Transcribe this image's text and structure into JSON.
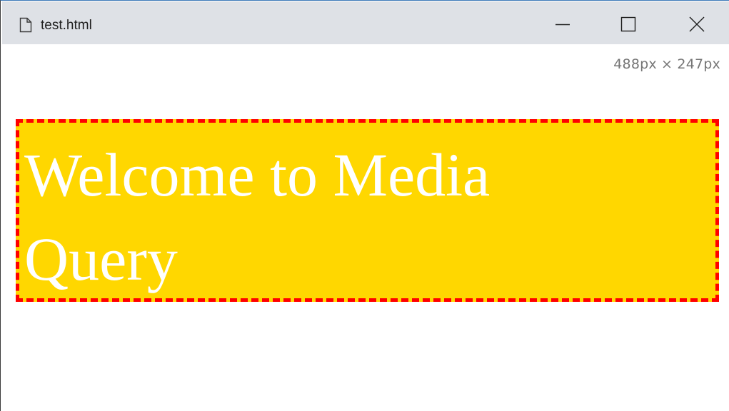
{
  "window": {
    "title": "test.html",
    "controls": {
      "minimize_icon": "minimize-icon",
      "maximize_icon": "maximize-icon",
      "close_icon": "close-icon"
    }
  },
  "viewport_readout": "488px × 247px",
  "content": {
    "heading": "Welcome to Media Query",
    "background_color": "#ffd700",
    "border_color": "#ff0000",
    "text_color": "#ffffff"
  }
}
